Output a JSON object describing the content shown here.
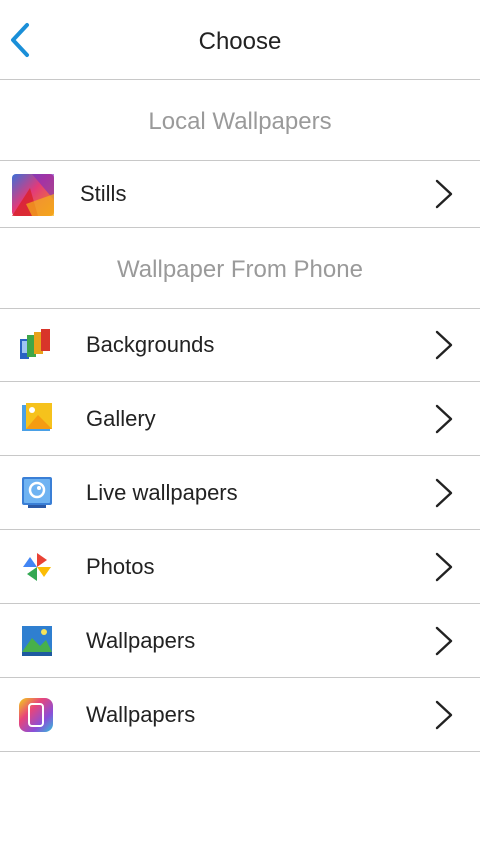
{
  "header": {
    "title": "Choose",
    "back_icon": "chevron-left-icon",
    "accent_color": "#1a8fd8"
  },
  "sections": {
    "local": {
      "title": "Local Wallpapers"
    },
    "phone": {
      "title": "Wallpaper From Phone"
    }
  },
  "local_items": [
    {
      "label": "Stills",
      "icon": "stills-icon"
    }
  ],
  "phone_items": [
    {
      "label": "Backgrounds",
      "icon": "backgrounds-icon"
    },
    {
      "label": "Gallery",
      "icon": "gallery-icon"
    },
    {
      "label": "Live wallpapers",
      "icon": "live-wallpapers-icon"
    },
    {
      "label": "Photos",
      "icon": "photos-icon"
    },
    {
      "label": "Wallpapers",
      "icon": "wallpapers-icon"
    },
    {
      "label": "Wallpapers",
      "icon": "wallpapers-alt-icon"
    }
  ],
  "row_chevron_icon": "chevron-right-icon"
}
